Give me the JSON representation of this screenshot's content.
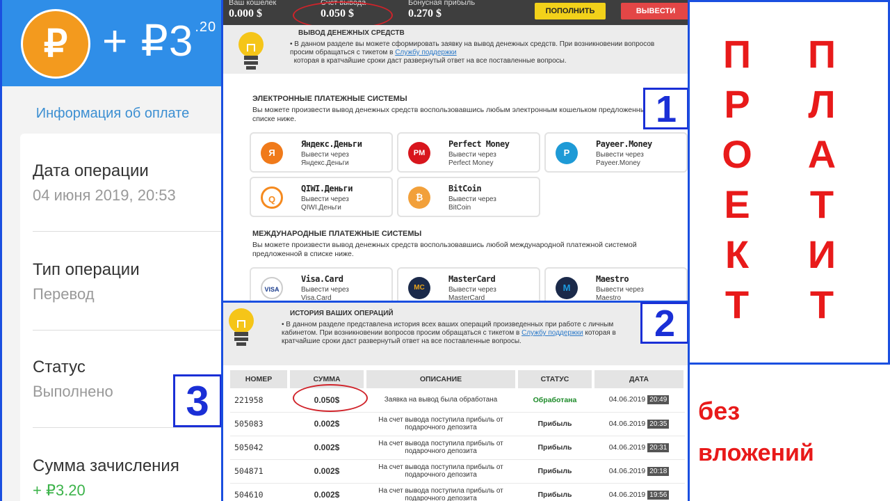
{
  "left": {
    "currency_symbol": "₽",
    "amount_main": "+ ₽3",
    "amount_fraction": ".20",
    "info_link": "Информация об оплате",
    "fields": [
      {
        "title": "Дата операции",
        "value": "04 июня 2019, 20:53"
      },
      {
        "title": "Тип операции",
        "value": "Перевод"
      },
      {
        "title": "Статус",
        "value": "Выполнено"
      },
      {
        "title": "Сумма зачисления",
        "value": "+ ₽3.20"
      }
    ]
  },
  "topbar": {
    "wallet_label": "Ваш кошелек",
    "wallet_value": "0.000 $",
    "withdraw_label": "Счет вывода",
    "withdraw_value": "0.050 $",
    "bonus_label": "Бонусная прибыль",
    "bonus_value": "0.270 $",
    "deposit_button": "ПОПОЛНИТЬ",
    "withdraw_button": "ВЫВЕСТИ"
  },
  "withdraw_notice": {
    "title": "ВЫВОД ДЕНЕЖНЫХ СРЕДСТВ",
    "text_a": "В данном разделе вы можете сформировать заявку на вывод денежных средств. При возникновении вопросов просим обращаться с тикетом в ",
    "link": "Службу поддержки",
    "text_b": "которая в кратчайшие сроки даст развернутый ответ на все поставленные вопросы."
  },
  "electronic": {
    "title": "ЭЛЕКТРОННЫЕ ПЛАТЕЖНЫЕ СИСТЕМЫ",
    "desc": "Вы можете произвести вывод денежных средств воспользовавшись любым электронным кошельком предложенным в списке ниже.",
    "items": [
      {
        "name": "Яндекс.Деньги",
        "via": "Вывести через",
        "target": "Яндекс.Деньги",
        "color": "#f07a1a",
        "glyph": "Я"
      },
      {
        "name": "Perfect Money",
        "via": "Вывести через",
        "target": "Perfect Money",
        "color": "#d8161d",
        "glyph": "PM"
      },
      {
        "name": "Payeer.Money",
        "via": "Вывести через",
        "target": "Payeer.Money",
        "color": "#1e9ad6",
        "glyph": "P"
      },
      {
        "name": "QIWI.Деньги",
        "via": "Вывести через",
        "target": "QIWI.Деньги",
        "color": "#f58a1f",
        "glyph": "Q"
      },
      {
        "name": "BitCoin",
        "via": "Вывести через",
        "target": "BitCoin",
        "color": "#f2a03a",
        "glyph": "₿"
      }
    ]
  },
  "international": {
    "title": "МЕЖДУНАРОДНЫЕ ПЛАТЕЖНЫЕ СИСТЕМЫ",
    "desc": "Вы можете произвести вывод денежных средств воспользовавшись любой международной платежной системой предложенной в списке ниже.",
    "items": [
      {
        "name": "Visa.Card",
        "via": "Вывести через",
        "target": "Visa.Card",
        "color": "#1a3c8c",
        "glyph": "VISA"
      },
      {
        "name": "MasterCard",
        "via": "Вывести через",
        "target": "MasterCard",
        "color": "#e8a21a",
        "glyph": "MC"
      },
      {
        "name": "Maestro",
        "via": "Вывести через",
        "target": "Maestro",
        "color": "#1c6bb8",
        "glyph": "M"
      }
    ]
  },
  "history_notice": {
    "title": "ИСТОРИЯ ВАШИХ ОПЕРАЦИЙ",
    "text_a": "В данном разделе представлена история всех ваших операций произведенных при работе с личным кабинетом. При возникновении вопросов просим обращаться с тикетом в ",
    "link": "Службу поддержки",
    "text_b": " которая в кратчайшие сроки даст развернутый ответ на все поставленные вопросы."
  },
  "table": {
    "headers": [
      "НОМЕР",
      "СУММА",
      "ОПИСАНИЕ",
      "СТАТУС",
      "ДАТА"
    ],
    "rows": [
      {
        "id": "221958",
        "sum": "0.050$",
        "desc": "Заявка на вывод была обработана",
        "status": "Обработана",
        "date": "04.06.2019",
        "time": "20:49"
      },
      {
        "id": "505083",
        "sum": "0.002$",
        "desc": "На счет вывода поступила прибыль от подарочного депозита",
        "status": "Прибыль",
        "date": "04.06.2019",
        "time": "20:35"
      },
      {
        "id": "505042",
        "sum": "0.002$",
        "desc": "На счет вывода поступила прибыль от подарочного депозита",
        "status": "Прибыль",
        "date": "04.06.2019",
        "time": "20:31"
      },
      {
        "id": "504871",
        "sum": "0.002$",
        "desc": "На счет вывода поступила прибыль от подарочного депозита",
        "status": "Прибыль",
        "date": "04.06.2019",
        "time": "20:18"
      },
      {
        "id": "504610",
        "sum": "0.002$",
        "desc": "На счет вывода поступила прибыль от подарочного депозита",
        "status": "Прибыль",
        "date": "04.06.2019",
        "time": "19:56"
      }
    ]
  },
  "markers": {
    "one": "1",
    "two": "2",
    "three": "3"
  },
  "overlay": {
    "col_left": [
      "П",
      "Р",
      "О",
      "Е",
      "К",
      "Т"
    ],
    "col_right": [
      "П",
      "Л",
      "А",
      "Т",
      "И",
      "Т"
    ],
    "note_line1": "без",
    "note_line2": "вложений"
  }
}
